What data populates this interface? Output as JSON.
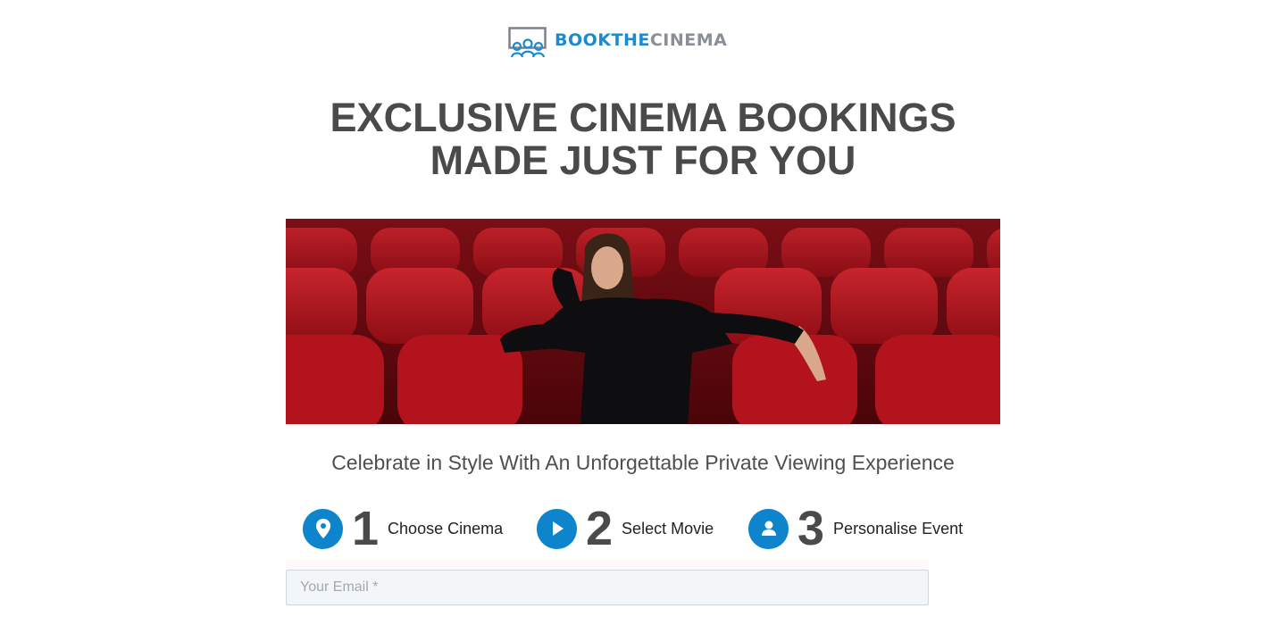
{
  "brand": {
    "name_part1": "BOOKTHE",
    "name_part2": "CINEMA",
    "primary_color": "#1a8bd0",
    "secondary_color": "#8a8f96"
  },
  "headline": {
    "line1": "EXCLUSIVE CINEMA BOOKINGS",
    "line2": "MADE JUST FOR YOU"
  },
  "hero": {
    "description": "Woman in black sweater seated in red velvet cinema seats"
  },
  "subheadline": "Celebrate in Style With An Unforgettable Private Viewing Experience",
  "steps": [
    {
      "number": "1",
      "label": "Choose Cinema",
      "icon": "map-pin-icon"
    },
    {
      "number": "2",
      "label": "Select Movie",
      "icon": "play-icon"
    },
    {
      "number": "3",
      "label": "Personalise Event",
      "icon": "user-icon"
    }
  ],
  "form": {
    "email_placeholder": "Your Email *",
    "email_value": ""
  },
  "colors": {
    "accent": "#0e84cd",
    "heading": "#4a4a4a",
    "seat_red": "#b3131d"
  }
}
